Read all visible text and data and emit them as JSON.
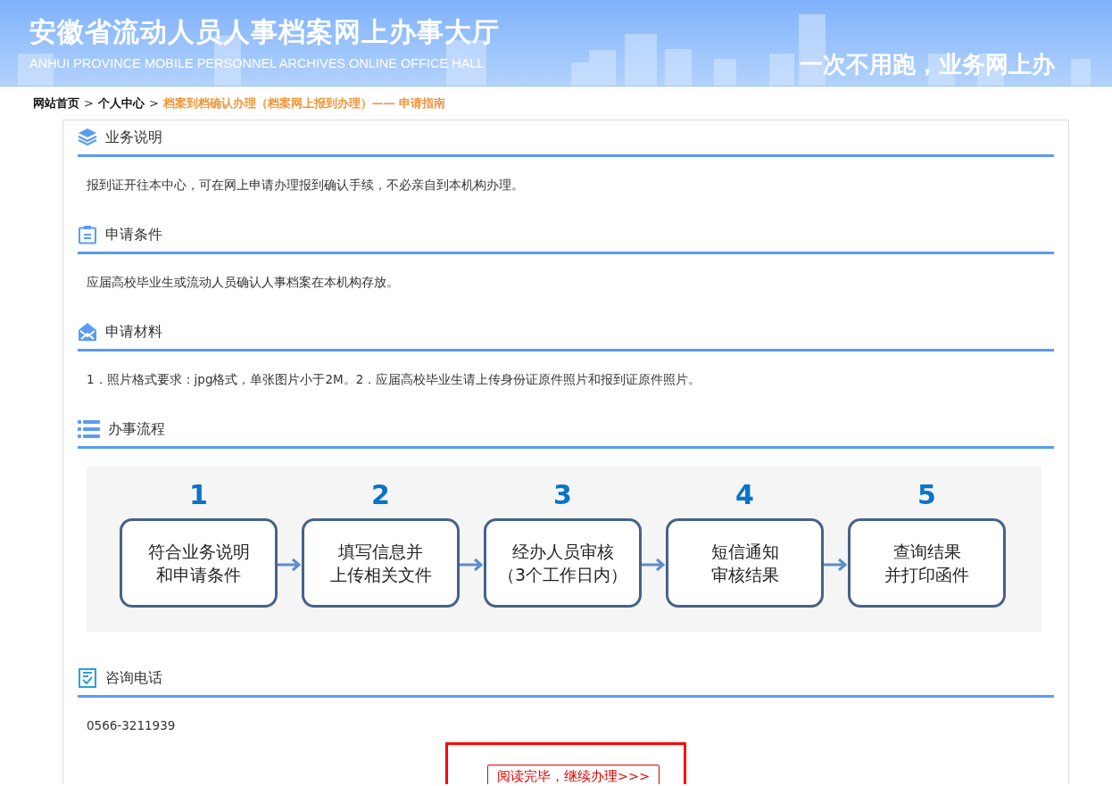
{
  "header": {
    "title": "安徽省流动人员人事档案网上办事大厅",
    "subtitle": "ANHUI PROVINCE MOBILE PERSONNEL ARCHIVES ONLINE OFFICE HALL",
    "slogan": "一次不用跑，业务网上办"
  },
  "breadcrumb": [
    {
      "kind": "link",
      "label": "网站首页"
    },
    {
      "kind": "separator",
      "label": ">"
    },
    {
      "kind": "link",
      "label": "个人中心"
    },
    {
      "kind": "separator",
      "label": ">"
    },
    {
      "kind": "current",
      "label": "档案到档确认办理（档案网上报到办理）—— 申请指南"
    }
  ],
  "sections": [
    {
      "kind": "text",
      "title": "业务说明",
      "body": "报到证开往本中心，可在网上申请办理报到确认手续，不必亲自到本机构办理。"
    },
    {
      "kind": "text",
      "title": "申请条件",
      "body": "应届高校毕业生或流动人员确认人事档案在本机构存放。"
    },
    {
      "kind": "text",
      "title": "申请材料",
      "body": "1．照片格式要求：jpg格式，单张图片小于2M。2．应届高校毕业生请上传身份证原件照片和报到证原件照片。"
    },
    {
      "kind": "flow",
      "title": "办事流程",
      "steps": [
        {
          "number": "1",
          "lines": [
            "符合业务说明",
            "和申请条件"
          ]
        },
        {
          "number": "2",
          "lines": [
            "填写信息并",
            "上传相关文件"
          ]
        },
        {
          "number": "3",
          "lines": [
            "经办人员审核",
            "（3个工作日内）"
          ]
        },
        {
          "number": "4",
          "lines": [
            "短信通知",
            "审核结果"
          ]
        },
        {
          "number": "5",
          "lines": [
            "查询结果",
            "并打印函件"
          ]
        }
      ]
    },
    {
      "kind": "text",
      "title": "咨询电话",
      "body": "0566-3211939"
    }
  ],
  "action": {
    "label": "阅读完毕，继续办理>>>",
    "highlighted": true
  }
}
